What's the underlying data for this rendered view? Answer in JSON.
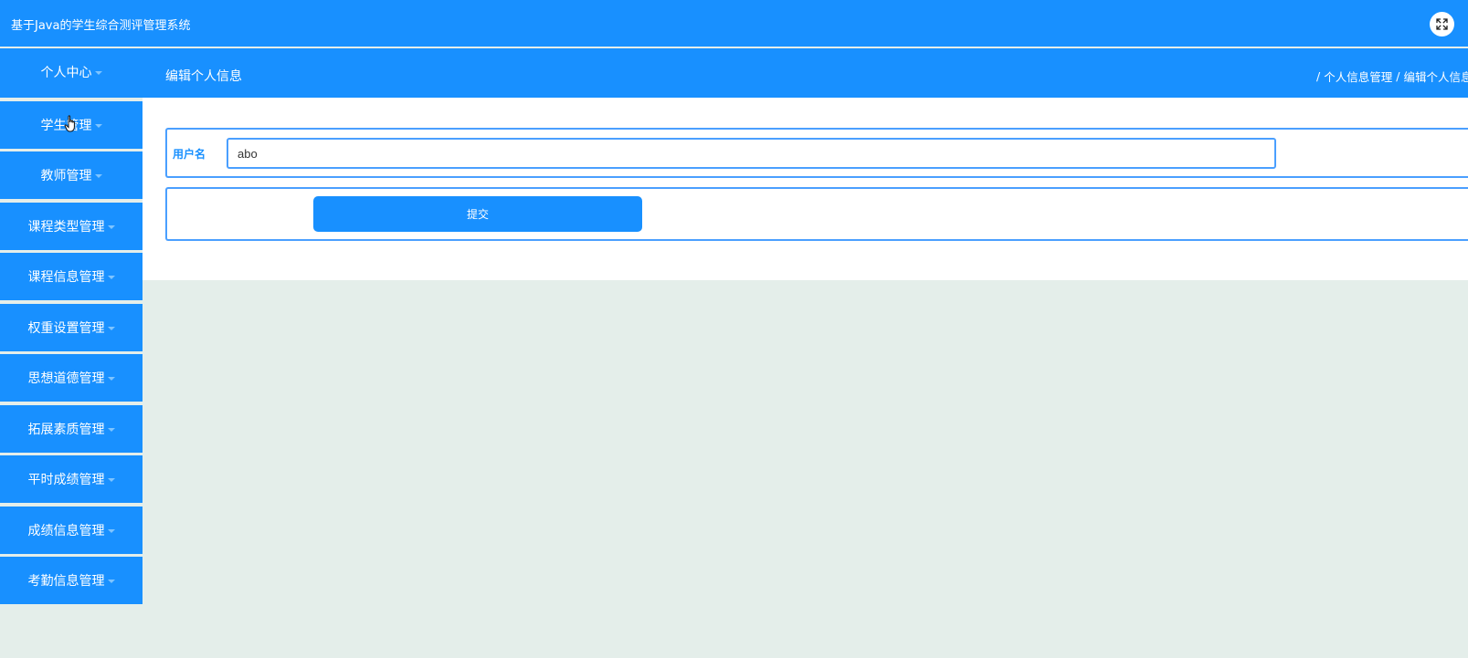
{
  "app": {
    "title": "基于Java的学生综合测评管理系统"
  },
  "header": {
    "fullscreen_icon": "fullscreen-icon"
  },
  "sidebar": {
    "items": [
      {
        "label": "个人中心"
      },
      {
        "label": "学生管理"
      },
      {
        "label": "教师管理"
      },
      {
        "label": "课程类型管理"
      },
      {
        "label": "课程信息管理"
      },
      {
        "label": "权重设置管理"
      },
      {
        "label": "思想道德管理"
      },
      {
        "label": "拓展素质管理"
      },
      {
        "label": "平时成绩管理"
      },
      {
        "label": "成绩信息管理"
      },
      {
        "label": "考勤信息管理"
      }
    ]
  },
  "main": {
    "page_title": "编辑个人信息",
    "breadcrumb": [
      "个人信息管理",
      "编辑个人信息"
    ],
    "form": {
      "username_label": "用户名",
      "username_value": "abo",
      "submit_label": "提交"
    }
  },
  "colors": {
    "primary": "#1890ff",
    "border": "#4a9fff",
    "page_background": "#e4eeea"
  }
}
